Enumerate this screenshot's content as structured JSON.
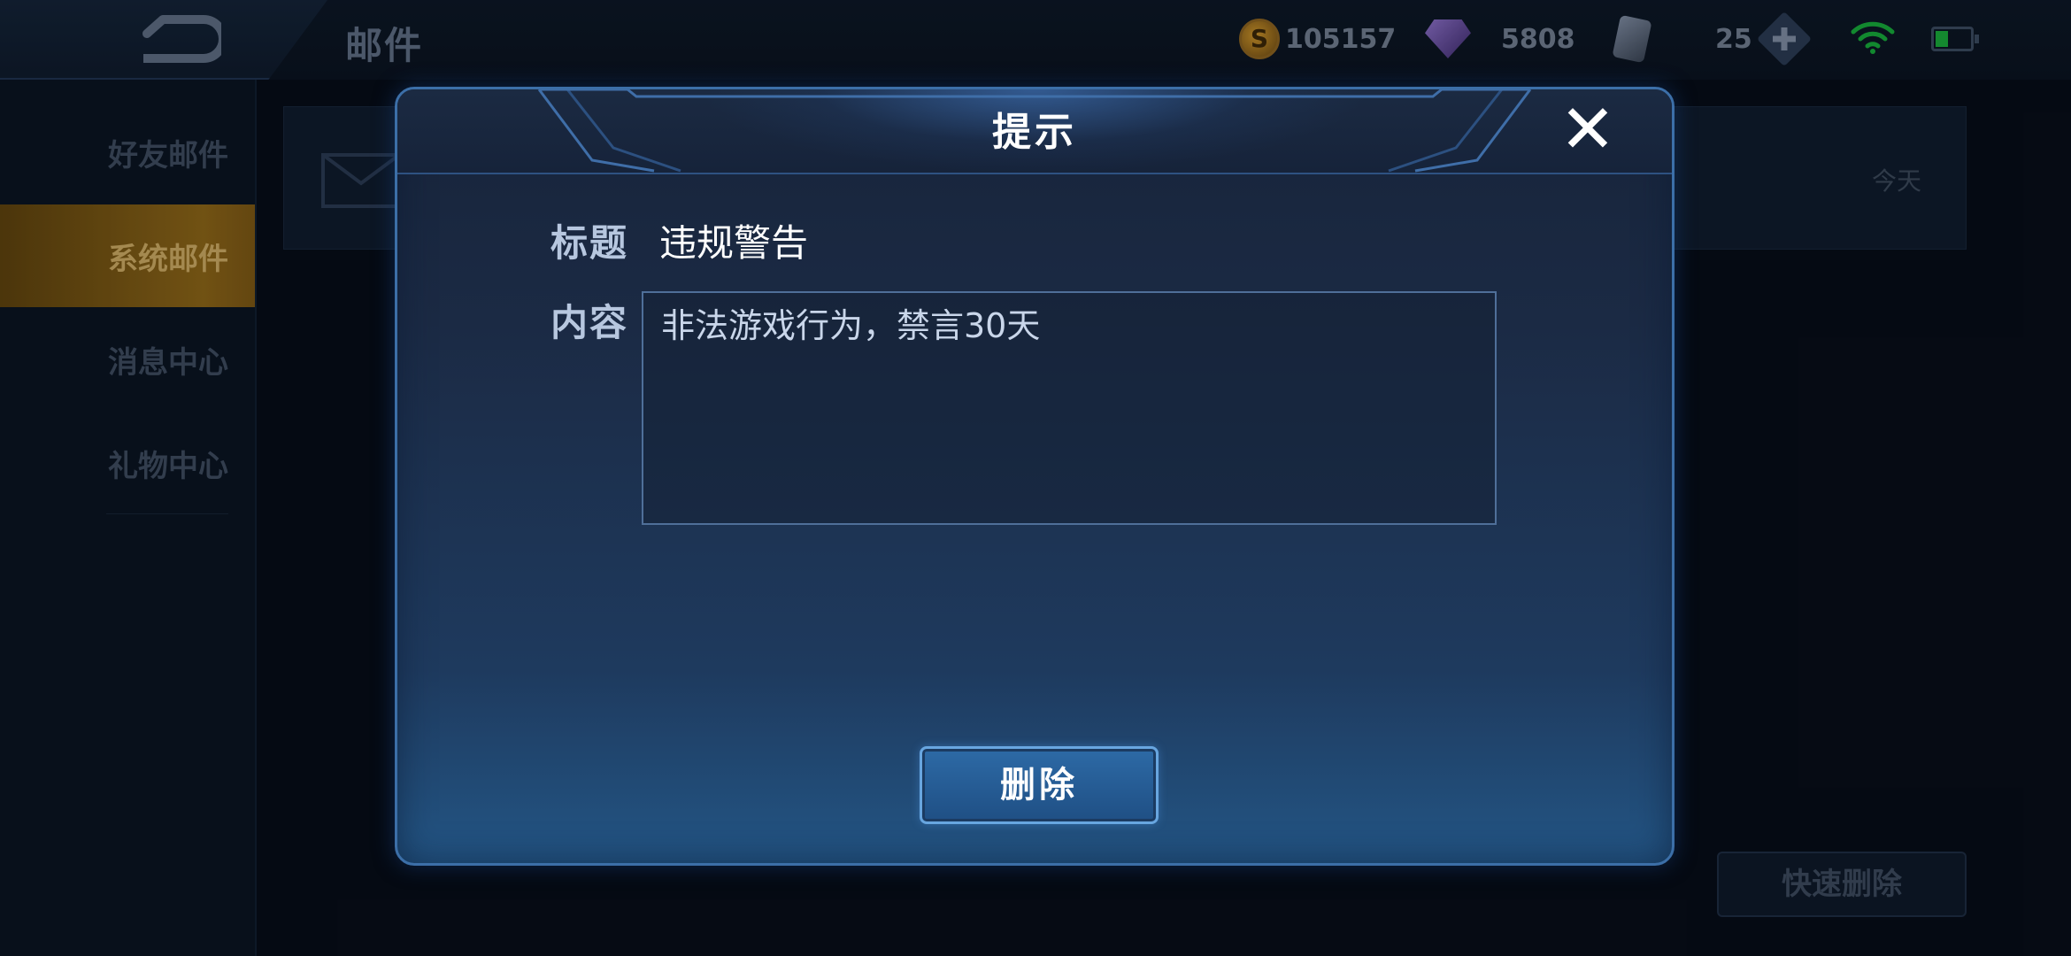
{
  "header": {
    "title": "邮件",
    "back_icon": "back-arrow-icon",
    "gold": "105157",
    "gems": "5808",
    "cards": "25",
    "icons": [
      "gold-coin-icon",
      "gem-icon",
      "card-icon",
      "plus-icon",
      "wifi-icon",
      "battery-icon"
    ]
  },
  "sidebar": {
    "items": [
      {
        "label": "好友邮件",
        "active": false
      },
      {
        "label": "系统邮件",
        "active": true
      },
      {
        "label": "消息中心",
        "active": false
      },
      {
        "label": "礼物中心",
        "active": false
      }
    ]
  },
  "mail_list": {
    "date": "今天",
    "icon": "envelope-icon"
  },
  "footer": {
    "quick_delete_label": "快速删除"
  },
  "dialog": {
    "title": "提示",
    "close_icon": "close-icon",
    "subject_label": "标题",
    "subject_value": "违规警告",
    "content_label": "内容",
    "content_value": "非法游戏行为，禁言30天",
    "delete_label": "删除"
  },
  "colors": {
    "accent_blue": "#3c6fa8",
    "active_gold": "#8a6418",
    "background": "#070d18"
  }
}
